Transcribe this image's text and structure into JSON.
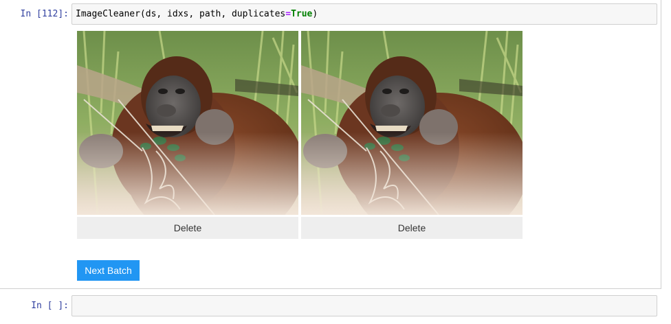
{
  "cells": [
    {
      "prompt": "In [112]:",
      "code": {
        "func": "ImageCleaner",
        "open_paren": "(",
        "args": "ds, idxs, path, duplicates",
        "eq": "=",
        "kw": "True",
        "close_paren": ")"
      }
    },
    {
      "prompt": "In [ ]:",
      "code": ""
    }
  ],
  "image_cleaner": {
    "tiles": [
      {
        "image": "orangutan-eating-photo",
        "delete_label": "Delete"
      },
      {
        "image": "orangutan-eating-photo",
        "delete_label": "Delete"
      }
    ],
    "next_batch_label": "Next Batch",
    "colors": {
      "next_batch_bg": "#2196f3",
      "delete_bg": "#eeeeee"
    }
  }
}
